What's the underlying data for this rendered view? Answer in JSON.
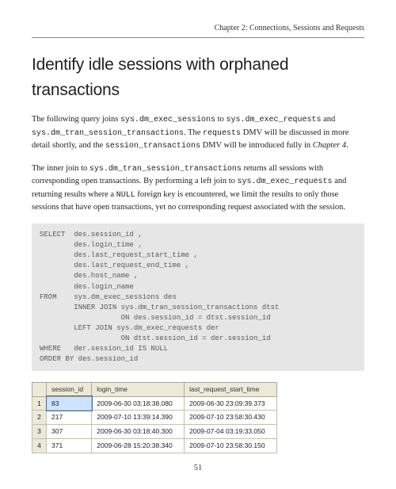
{
  "header": {
    "chapter": "Chapter 2: Connections, Sessions and Requests"
  },
  "title": "Identify idle sessions with orphaned transactions",
  "para1": {
    "t1": "The following query joins ",
    "c1": "sys.dm_exec_sessions",
    "t2": " to ",
    "c2": "sys.dm_exec_requests",
    "t3": " and ",
    "c3": "sys.dm_tran_session_transactions",
    "t4": ". The ",
    "c4": "requests",
    "t5": " DMV will be discussed in more detail shortly, and the ",
    "c5": "session_transactions",
    "t6": " DMV will be introduced fully in ",
    "i1": "Chapter 4",
    "t7": "."
  },
  "para2": {
    "t1": "The inner join to ",
    "c1": "sys.dm_tran_session_transactions",
    "t2": " returns all sessions with corresponding open transactions. By performing a left join to ",
    "c2": "sys.dm_exec_requests",
    "t3": " and returning results where a ",
    "c3": "NULL",
    "t4": " foreign key is encountered, we limit the results to only those sessions that have open transactions, yet no corresponding request associated with the session."
  },
  "code": {
    "l1": "SELECT  des.session_id ,",
    "l2": "        des.login_time ,",
    "l3": "        des.last_request_start_time ,",
    "l4": "        des.last_request_end_time ,",
    "l5": "        des.host_name ,",
    "l6": "        des.login_name",
    "l7": "FROM    sys.dm_exec_sessions des",
    "l8": "        INNER JOIN sys.dm_tran_session_transactions dtst",
    "l9": "                   ON des.session_id = dtst.session_id",
    "l10": "        LEFT JOIN sys.dm_exec_requests der",
    "l11": "                   ON dtst.session_id = der.session_id",
    "l12": "WHERE   der.session_id IS NULL",
    "l13": "ORDER BY des.session_id"
  },
  "table": {
    "headers": {
      "c1": "session_id",
      "c2": "login_time",
      "c3": "last_request_start_time"
    },
    "rows": [
      {
        "n": "1",
        "session_id": "83",
        "login_time": "2009-06-30 03:18:38.080",
        "last_request_start_time": "2009-06-30 23:09:39.373"
      },
      {
        "n": "2",
        "session_id": "217",
        "login_time": "2009-07-10 13:39:14.390",
        "last_request_start_time": "2009-07-10 23:58:30.430"
      },
      {
        "n": "3",
        "session_id": "307",
        "login_time": "2009-06-30 03:18:40.300",
        "last_request_start_time": "2009-07-04 03:19:33.050"
      },
      {
        "n": "4",
        "session_id": "371",
        "login_time": "2009-06-28 15:20:38.340",
        "last_request_start_time": "2009-07-10 23:58:30.150"
      }
    ]
  },
  "pagenum": "51"
}
